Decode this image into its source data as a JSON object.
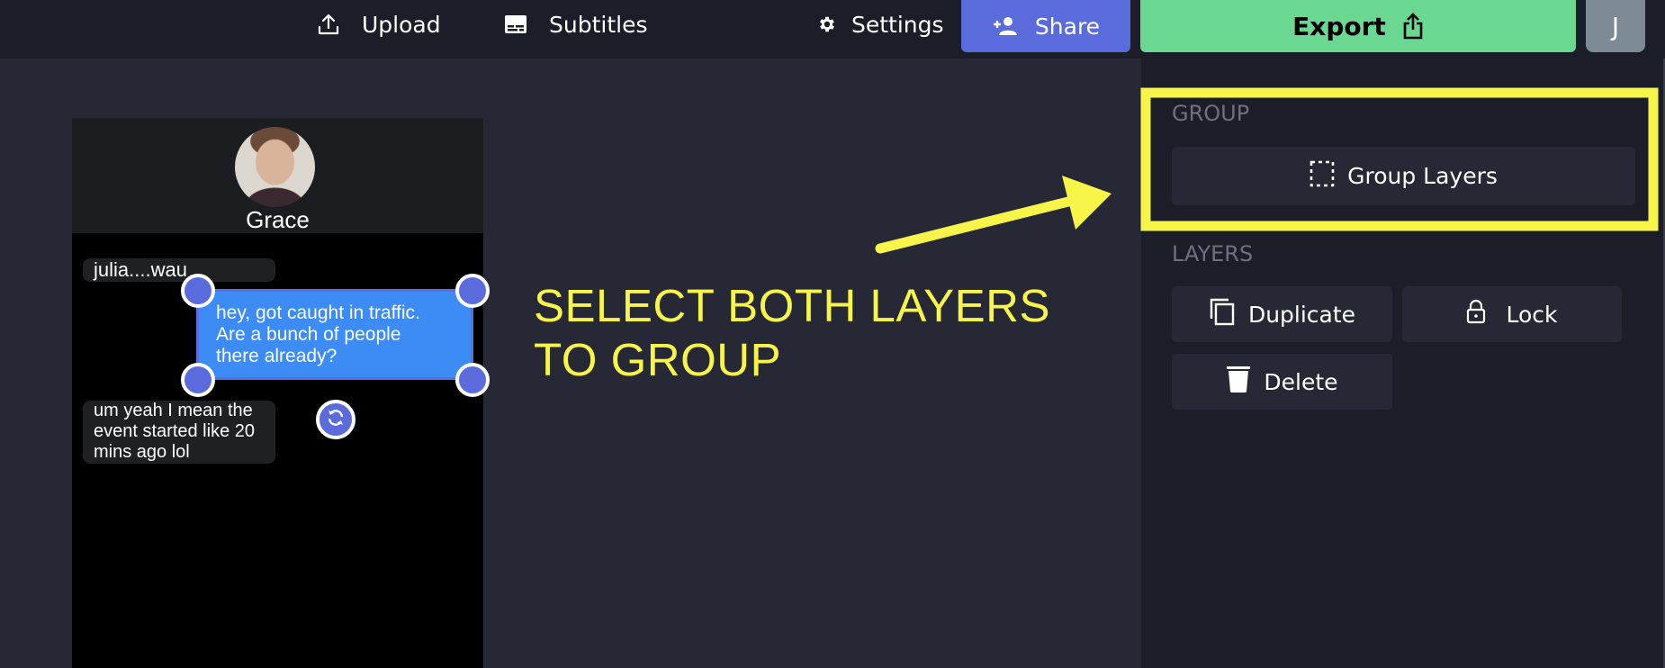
{
  "header": {
    "upload_label": "Upload",
    "subtitles_label": "Subtitles",
    "settings_label": "Settings",
    "share_label": "Share",
    "export_label": "Export",
    "avatar_initial": "J",
    "colors": {
      "share": "#5a6bdc",
      "export": "#6bd892",
      "avatar": "#7d8a96"
    }
  },
  "canvas": {
    "contact_name": "Grace",
    "messages": [
      {
        "sender": "them",
        "text": "julia....wau"
      },
      {
        "sender": "me",
        "text": "hey, got caught in traffic. Are a bunch of people there already?",
        "lines": [
          "hey, got caught in traffic.",
          "Are a bunch of people",
          "there already?"
        ],
        "selected": true
      },
      {
        "sender": "them",
        "text": "um yeah I mean the event started like 20 mins ago lol",
        "lines": [
          "um yeah I mean the",
          "event started like 20",
          "mins ago lol"
        ]
      }
    ]
  },
  "annotation": {
    "lines": [
      "SELECT BOTH LAYERS",
      "TO GROUP"
    ],
    "color": "#f7f54a"
  },
  "panel": {
    "group_section_label": "GROUP",
    "group_layers_label": "Group Layers",
    "layers_section_label": "LAYERS",
    "duplicate_label": "Duplicate",
    "lock_label": "Lock",
    "delete_label": "Delete"
  }
}
